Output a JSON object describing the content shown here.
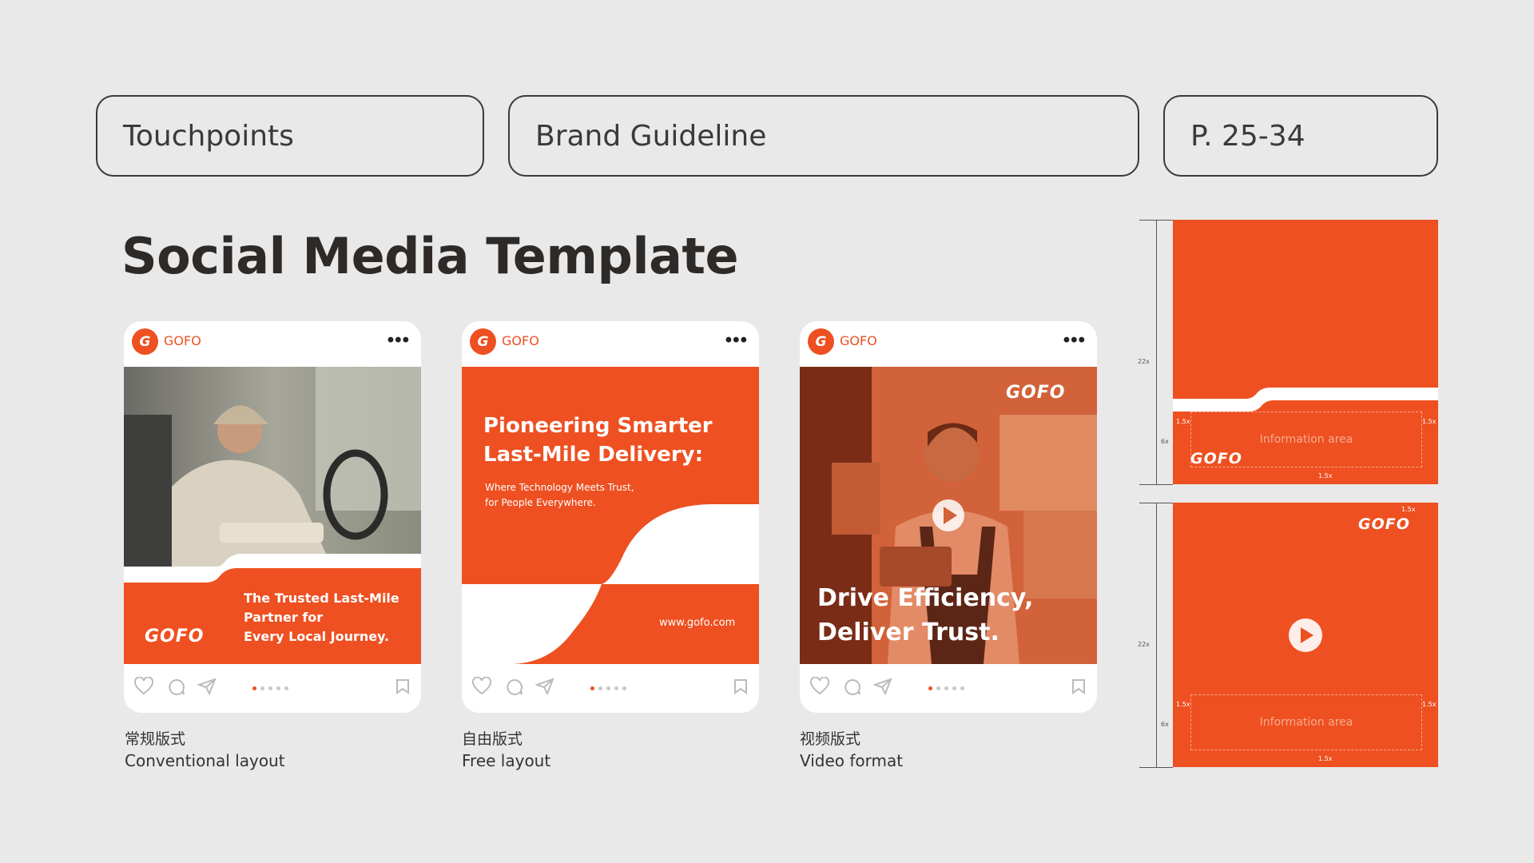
{
  "header": {
    "section": "Touchpoints",
    "document": "Brand Guideline",
    "pages": "P. 25-34"
  },
  "page_title": "Social Media Template",
  "brand": {
    "name": "GOFO",
    "logo_word": "GOFO",
    "badge": "G",
    "accent": "#ee5021"
  },
  "cards": [
    {
      "headline": [
        "The Trusted Last-Mile",
        "Partner for",
        "Every Local Journey."
      ],
      "caption_cn": "常规版式",
      "caption_en": "Conventional layout"
    },
    {
      "headline": [
        "Pioneering Smarter",
        "Last-Mile Delivery:"
      ],
      "subline": [
        "Where Technology Meets Trust,",
        "for People Everywhere."
      ],
      "url": "www.gofo.com",
      "caption_cn": "自由版式",
      "caption_en": "Free layout"
    },
    {
      "headline": [
        "Drive Efficiency,",
        "Deliver Trust."
      ],
      "caption_cn": "视频版式",
      "caption_en": "Video format"
    }
  ],
  "specs": {
    "info_area": "Information area",
    "height_mark": "22x",
    "margin_mark": "6x",
    "logo_mark": "1.5x"
  }
}
